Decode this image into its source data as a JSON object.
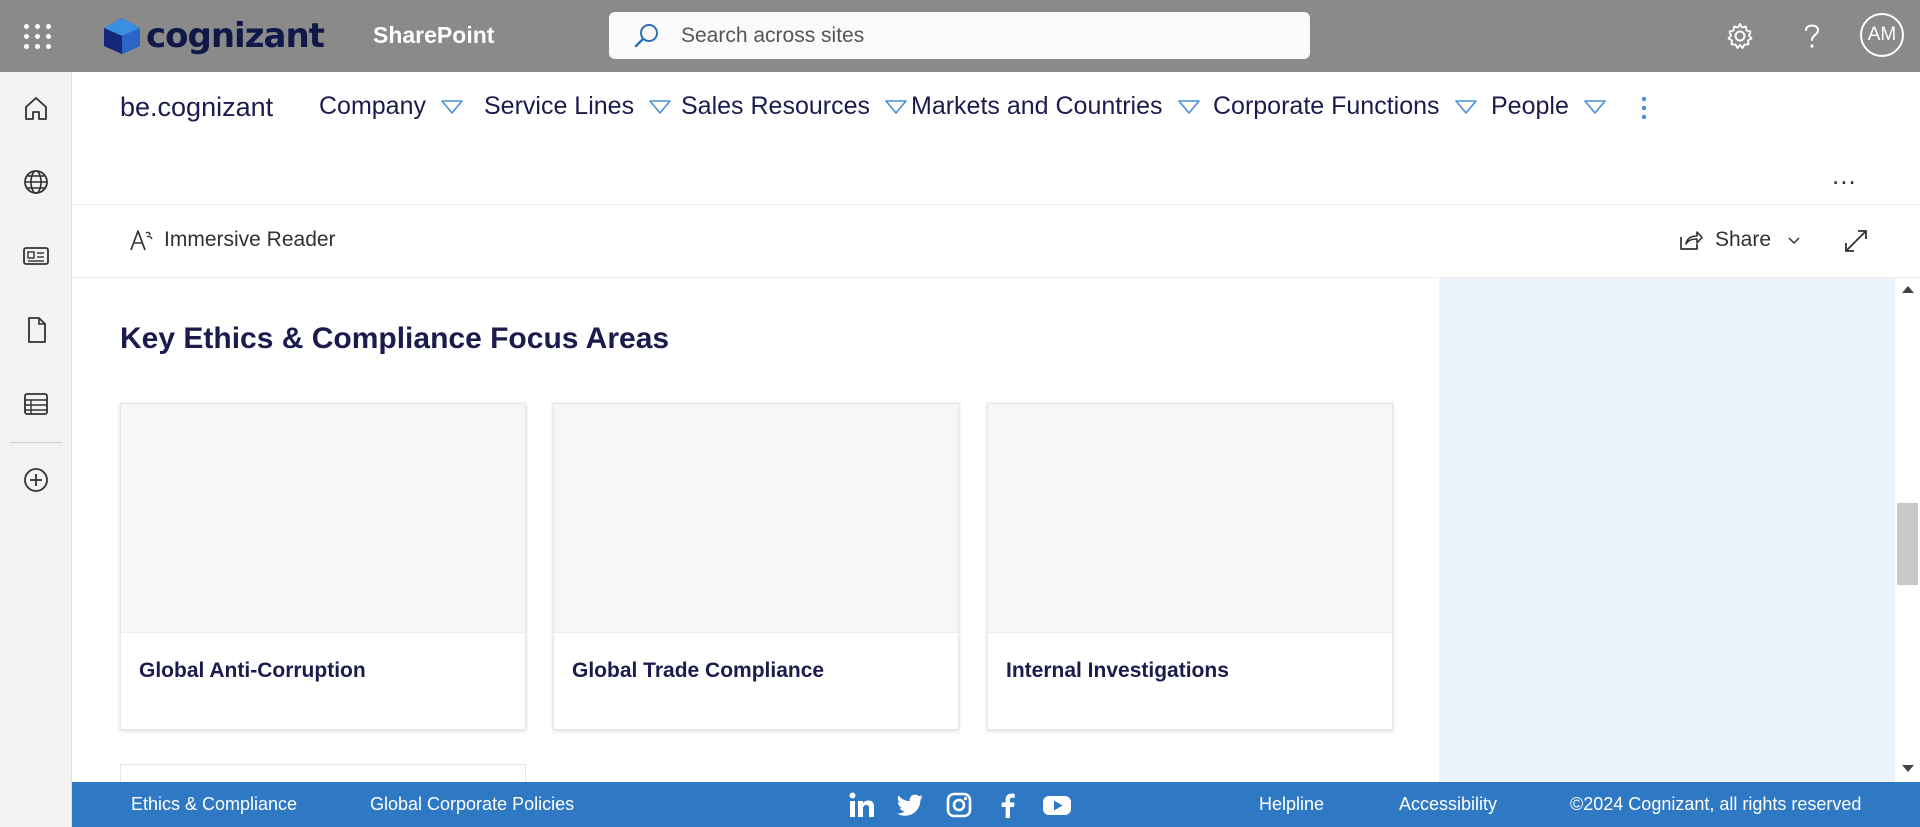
{
  "suite_bar": {
    "logo_text": "cognizant",
    "app_name": "SharePoint",
    "search_placeholder": "Search across sites",
    "avatar_initials": "AM",
    "background": "#8a8a8a"
  },
  "left_rail": {
    "items": [
      "home-icon",
      "globe-icon",
      "news-icon",
      "document-icon",
      "list-icon",
      "add-icon"
    ]
  },
  "hub_nav": {
    "site_title": "be.cognizant",
    "items": [
      {
        "label": "Company"
      },
      {
        "label": "Service Lines"
      },
      {
        "label": "Sales Resources"
      },
      {
        "label": "Markets and Countries"
      },
      {
        "label": "Corporate Functions"
      },
      {
        "label": "People"
      }
    ],
    "more": "..."
  },
  "command_bar": {
    "immersive_reader": "Immersive Reader",
    "share": "Share"
  },
  "main": {
    "section_title": "Key Ethics & Compliance Focus Areas",
    "cards": [
      {
        "title": "Global Anti-Corruption"
      },
      {
        "title": "Global Trade Compliance"
      },
      {
        "title": "Internal Investigations"
      }
    ]
  },
  "footer": {
    "links_left": [
      "Ethics & Compliance",
      "Global Corporate Policies"
    ],
    "social": [
      "linkedin-icon",
      "twitter-icon",
      "instagram-icon",
      "facebook-icon",
      "youtube-icon"
    ],
    "links_right": [
      "Helpline",
      "Accessibility"
    ],
    "copyright": "©2024 Cognizant, all rights reserved",
    "background": "#2f78c4"
  },
  "colors": {
    "accent": "#2f78c4",
    "text_dark": "#1b1b4e",
    "side_panel": "#ebf2fa"
  }
}
